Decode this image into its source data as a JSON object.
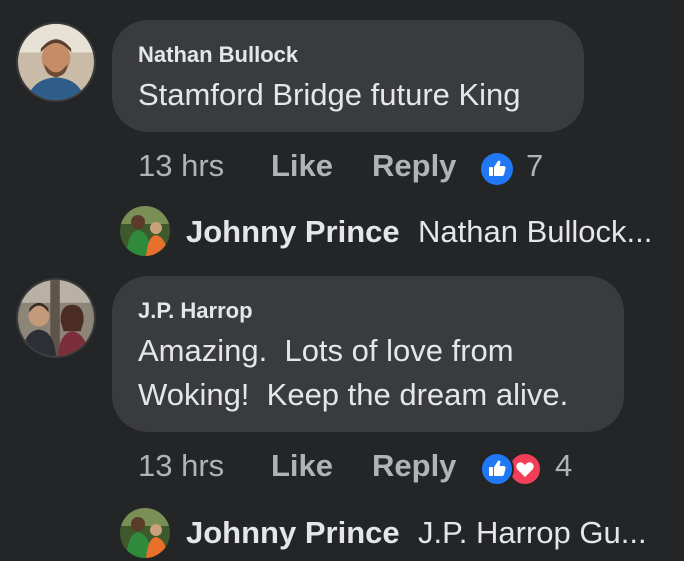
{
  "comments": [
    {
      "author": "Nathan Bullock",
      "text": "Stamford Bridge future King",
      "time": "13 hrs",
      "like_label": "Like",
      "reply_label": "Reply",
      "reactions": [
        "like-icon"
      ],
      "reaction_count": "7",
      "reply_preview": {
        "author": "Johnny Prince",
        "snippet": "Nathan Bullock..."
      }
    },
    {
      "author": "J.P. Harrop",
      "text_line1": "Amazing.  Lots of love from",
      "text_line2": "Woking!  Keep the dream alive.",
      "time": "13 hrs",
      "like_label": "Like",
      "reply_label": "Reply",
      "reactions": [
        "like-icon",
        "love-icon"
      ],
      "reaction_count": "4",
      "reply_preview": {
        "author": "Johnny Prince",
        "snippet": "J.P. Harrop Gu..."
      }
    }
  ],
  "colors": {
    "background": "#242526",
    "bubble": "#3a3b3c",
    "text_primary": "#e4e6eb",
    "text_secondary": "#b0b3b8",
    "like_blue": "#2078f4",
    "love_red": "#f33e58"
  }
}
